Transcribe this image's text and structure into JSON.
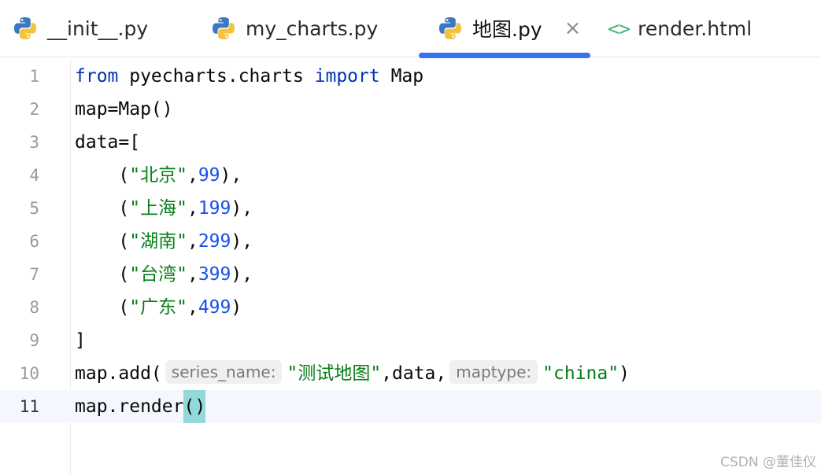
{
  "tabs": [
    {
      "label": "__init__.py",
      "icon": "python-icon",
      "active": false
    },
    {
      "label": "my_charts.py",
      "icon": "python-icon",
      "active": false
    },
    {
      "label": "地图.py",
      "icon": "python-icon",
      "active": true,
      "close": "×"
    },
    {
      "label": "render.html",
      "icon": "html-tag-icon",
      "icon_glyph": "<>",
      "active": false
    }
  ],
  "editor": {
    "current_line": 11,
    "lines": [
      {
        "n": "1",
        "tokens": [
          [
            "kw",
            "from"
          ],
          [
            "plain",
            " pyecharts.charts "
          ],
          [
            "kw",
            "import"
          ],
          [
            "plain",
            " Map"
          ]
        ]
      },
      {
        "n": "2",
        "tokens": [
          [
            "plain",
            "map=Map()"
          ]
        ]
      },
      {
        "n": "3",
        "tokens": [
          [
            "plain",
            "data=["
          ]
        ]
      },
      {
        "n": "4",
        "tokens": [
          [
            "plain",
            "    ("
          ],
          [
            "str",
            "\"北京\""
          ],
          [
            "plain",
            ","
          ],
          [
            "num",
            "99"
          ],
          [
            "plain",
            "),"
          ]
        ]
      },
      {
        "n": "5",
        "tokens": [
          [
            "plain",
            "    ("
          ],
          [
            "str",
            "\"上海\""
          ],
          [
            "plain",
            ","
          ],
          [
            "num",
            "199"
          ],
          [
            "plain",
            "),"
          ]
        ]
      },
      {
        "n": "6",
        "tokens": [
          [
            "plain",
            "    ("
          ],
          [
            "str",
            "\"湖南\""
          ],
          [
            "plain",
            ","
          ],
          [
            "num",
            "299"
          ],
          [
            "plain",
            "),"
          ]
        ]
      },
      {
        "n": "7",
        "tokens": [
          [
            "plain",
            "    ("
          ],
          [
            "str",
            "\"台湾\""
          ],
          [
            "plain",
            ","
          ],
          [
            "num",
            "399"
          ],
          [
            "plain",
            "),"
          ]
        ]
      },
      {
        "n": "8",
        "tokens": [
          [
            "plain",
            "    ("
          ],
          [
            "str",
            "\"广东\""
          ],
          [
            "plain",
            ","
          ],
          [
            "num",
            "499"
          ],
          [
            "plain",
            ")"
          ]
        ]
      },
      {
        "n": "9",
        "tokens": [
          [
            "plain",
            "]"
          ]
        ]
      },
      {
        "n": "10",
        "tokens": [
          [
            "plain",
            "map.add("
          ],
          [
            "hint",
            "series_name:"
          ],
          [
            "str",
            "\"测试地图\""
          ],
          [
            "plain",
            ",data,"
          ],
          [
            "hint",
            "maptype:"
          ],
          [
            "str",
            "\"china\""
          ],
          [
            "plain",
            ")"
          ]
        ]
      },
      {
        "n": "11",
        "tokens": [
          [
            "plain",
            "map.render"
          ],
          [
            "match",
            "()"
          ]
        ]
      }
    ]
  },
  "watermark": "CSDN @董佳仪",
  "colors": {
    "accent": "#3574f0",
    "keyword": "#0033b3",
    "string": "#067d17",
    "number": "#1750eb",
    "current_line_bg": "#f4f7fe",
    "bracket_match_bg": "#93d9d9"
  }
}
